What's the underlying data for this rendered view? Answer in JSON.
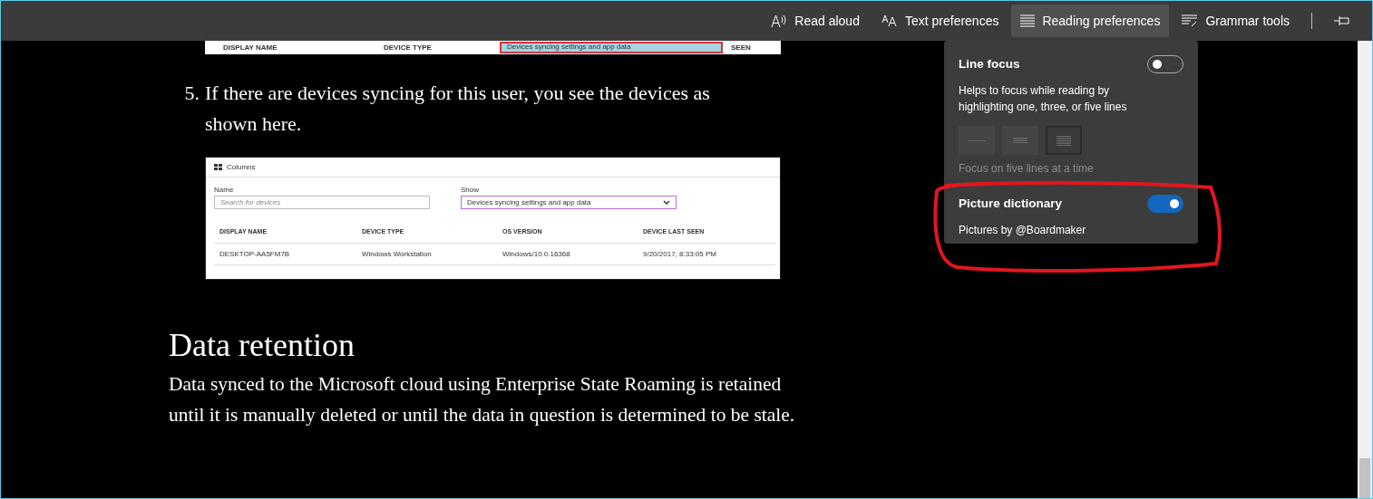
{
  "toolbar": {
    "items": [
      {
        "kind": "read-aloud",
        "label": "Read aloud",
        "selected": false
      },
      {
        "kind": "text-preferences",
        "label": "Text preferences",
        "selected": false
      },
      {
        "kind": "reading-preferences",
        "label": "Reading preferences",
        "selected": true
      },
      {
        "kind": "grammar-tools",
        "label": "Grammar tools",
        "selected": false
      }
    ]
  },
  "article": {
    "top_figure": {
      "columns": [
        "DISPLAY NAME",
        "DEVICE TYPE",
        "SEEN"
      ],
      "dropdown": "Devices syncing settings and app data"
    },
    "steps": [
      {
        "number": "5.",
        "text": "If there are devices syncing for this user, you see the devices as shown here."
      }
    ],
    "figure": {
      "toolbar_label": "Columns",
      "name_label": "Name",
      "name_placeholder": "Search for devices",
      "show_label": "Show",
      "show_value": "Devices syncing settings and app data",
      "columns": [
        "DISPLAY NAME",
        "DEVICE TYPE",
        "OS VERSION",
        "DEVICE LAST SEEN"
      ],
      "rows": [
        [
          "DESKTOP-AA5FM7B",
          "Windows Workstation",
          "Windows/10.0.16368",
          "9/20/2017, 8:33:05 PM"
        ]
      ]
    },
    "heading": "Data retention",
    "paragraph": "Data synced to the Microsoft cloud using Enterprise State Roaming is retained until it is manually deleted or until the data in question is determined to be stale."
  },
  "panel": {
    "line_focus": {
      "title": "Line focus",
      "description": "Helps to focus while reading by highlighting one, three, or five lines",
      "on": false,
      "options": [
        {
          "kind": "one",
          "selected": false
        },
        {
          "kind": "three",
          "selected": false
        },
        {
          "kind": "five",
          "selected": true
        }
      ],
      "hint": "Focus on five lines at a time"
    },
    "picture_dictionary": {
      "title": "Picture dictionary",
      "description": "Pictures by @Boardmaker",
      "on": true
    }
  }
}
